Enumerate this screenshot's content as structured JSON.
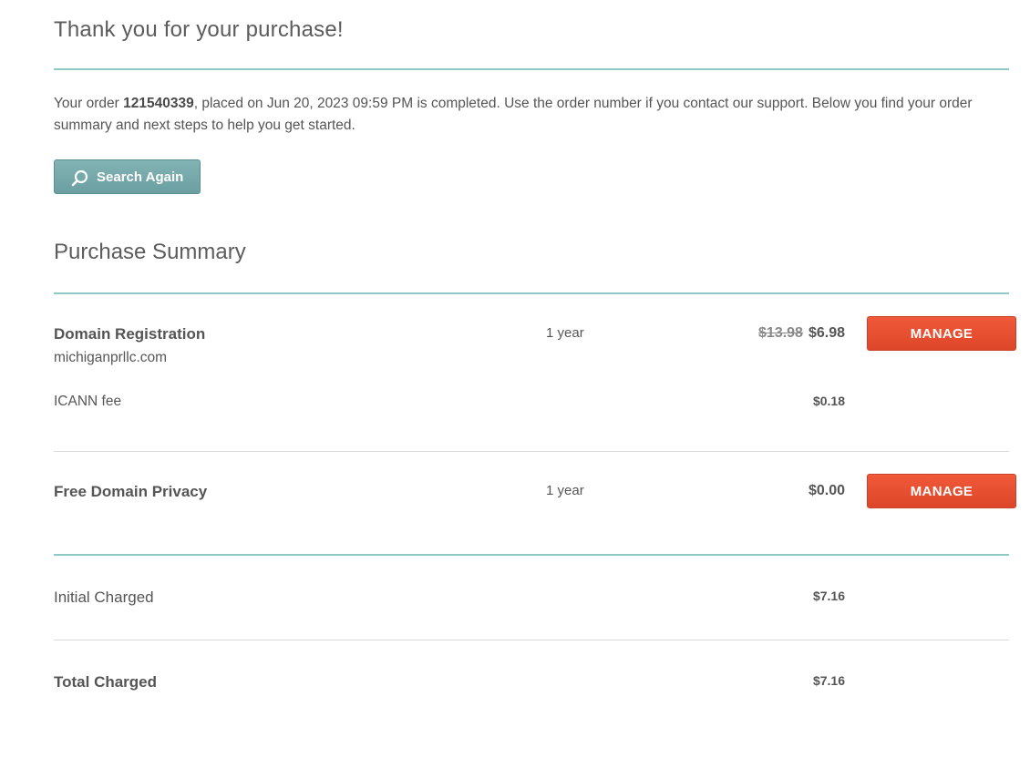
{
  "header": {
    "title": "Thank you for your purchase!"
  },
  "intro": {
    "prefix": "Your order ",
    "order_number": "121540339",
    "suffix": ", placed on Jun 20, 2023 09:59 PM is completed. Use the order number if you contact our support. Below you find your order summary and next steps to help you get started."
  },
  "search_button": {
    "label": "Search Again",
    "icon": "search-icon"
  },
  "summary": {
    "title": "Purchase Summary",
    "items": [
      {
        "name": "Domain Registration",
        "domain": "michiganprllc.com",
        "term": "1 year",
        "old_price": "$13.98",
        "price": "$6.98",
        "manage_label": "MANAGE",
        "fee_label": "ICANN fee",
        "fee_price": "$0.18"
      },
      {
        "name": "Free Domain Privacy",
        "term": "1 year",
        "price": "$0.00",
        "manage_label": "MANAGE"
      }
    ],
    "initial_label": "Initial Charged",
    "initial_value": "$7.16",
    "total_label": "Total Charged",
    "total_value": "$7.16"
  },
  "colors": {
    "teal_rule": "#8ecac3",
    "search_button": "#6fa3a5",
    "manage_button": "#e64e30",
    "text": "#555555"
  }
}
